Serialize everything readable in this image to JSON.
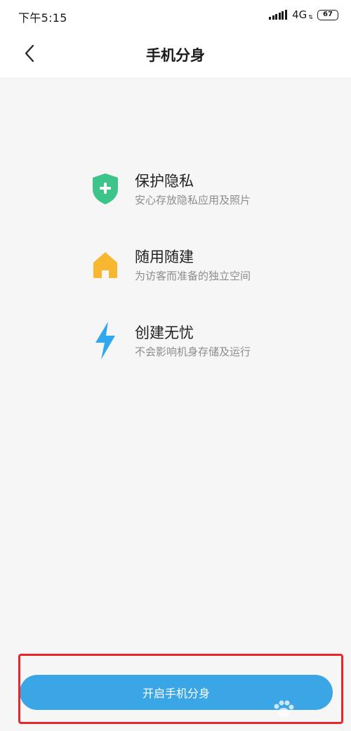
{
  "status_bar": {
    "time": "下午5:15",
    "network": "4G",
    "battery": "67"
  },
  "header": {
    "title": "手机分身",
    "back_icon": "chevron-left-icon"
  },
  "features": [
    {
      "icon": "shield-plus-icon",
      "color": "#3cc48a",
      "title": "保护隐私",
      "desc": "安心存放隐私应用及照片"
    },
    {
      "icon": "house-icon",
      "color": "#f7b731",
      "title": "随用随建",
      "desc": "为访客而准备的独立空间"
    },
    {
      "icon": "lightning-icon",
      "color": "#2fa8f0",
      "title": "创建无忧",
      "desc": "不会影响机身存储及运行"
    }
  ],
  "cta": {
    "label": "开启手机分身",
    "color": "#3aa6e6"
  },
  "highlight_color": "#e8262b"
}
